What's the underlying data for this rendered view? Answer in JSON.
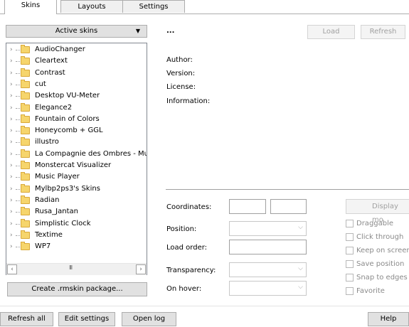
{
  "tabs": [
    {
      "label": "Skins",
      "active": true
    },
    {
      "label": "Layouts",
      "active": false
    },
    {
      "label": "Settings",
      "active": false
    }
  ],
  "left": {
    "active_skins_label": "Active skins",
    "skins": [
      "AudioChanger",
      "Cleartext",
      "Contrast",
      "cut",
      "Desktop VU-Meter",
      "Elegance2",
      "Fountain of Colors",
      "Honeycomb + GGL",
      "illustro",
      "La Compagnie des Ombres - Mu",
      "Monstercat Visualizer",
      "Music Player",
      "Mylbp2ps3's Skins",
      "Radian",
      "Rusa_Jantan",
      "Simplistic Clock",
      "Textime",
      "WP7"
    ],
    "scroll_grip": "III",
    "create_package_label": "Create .rmskin package..."
  },
  "right": {
    "skin_name": "...",
    "load_label": "Load",
    "refresh_label": "Refresh",
    "info_labels": {
      "author": "Author:",
      "version": "Version:",
      "license": "License:",
      "information": "Information:"
    },
    "fields": {
      "coordinates": "Coordinates:",
      "position": "Position:",
      "load_order": "Load order:",
      "transparency": "Transparency:",
      "on_hover": "On hover:"
    },
    "display_monitor_label": "Display mo",
    "checkboxes": [
      "Draggable",
      "Click through",
      "Keep on screen",
      "Save position",
      "Snap to edges",
      "Favorite"
    ]
  },
  "bottom": {
    "refresh_all": "Refresh all",
    "edit_settings": "Edit settings",
    "open_log": "Open log",
    "help": "Help"
  },
  "icons": {
    "dropdown": "chevron-down-icon",
    "folder": "folder-icon",
    "expander": "chevron-right-icon"
  }
}
